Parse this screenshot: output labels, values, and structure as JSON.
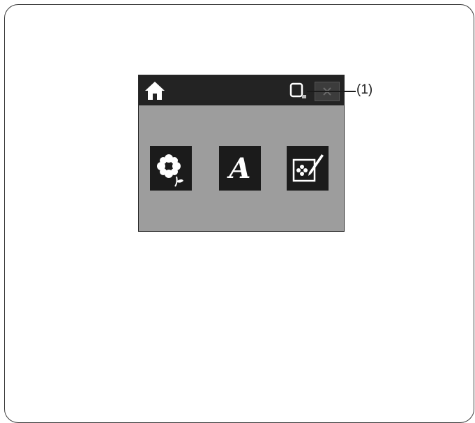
{
  "screen": {
    "topbar": {
      "home_icon": "home-icon",
      "screen_icon": "screen-preview-icon",
      "close_icon": "close-icon"
    },
    "mode_buttons": [
      {
        "icon": "flower-pattern-icon"
      },
      {
        "icon": "script-letter-a-icon",
        "glyph": "A"
      },
      {
        "icon": "edit-pattern-icon"
      }
    ]
  },
  "callout": {
    "label": "(1)"
  }
}
